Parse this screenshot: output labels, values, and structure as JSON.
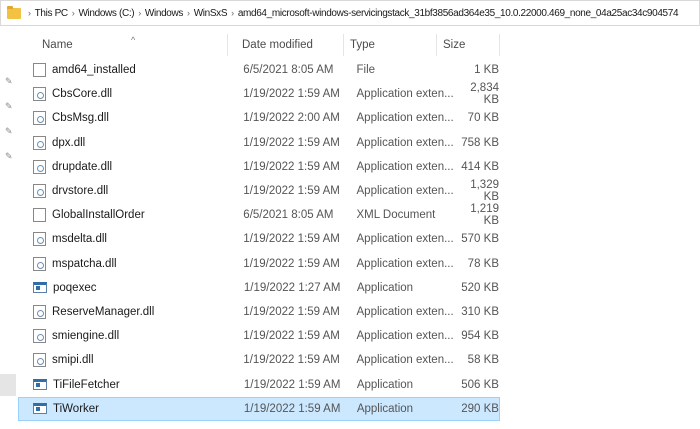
{
  "breadcrumb": [
    "This PC",
    "Windows (C:)",
    "Windows",
    "WinSxS",
    "amd64_microsoft-windows-servicingstack_31bf3856ad364e35_10.0.22000.469_none_04a25ac34c904574"
  ],
  "columns": {
    "name": "Name",
    "date": "Date modified",
    "type": "Type",
    "size": "Size"
  },
  "files": [
    {
      "name": "amd64_installed",
      "date": "6/5/2021 8:05 AM",
      "type": "File",
      "size": "1 KB",
      "icon": "file"
    },
    {
      "name": "CbsCore.dll",
      "date": "1/19/2022 1:59 AM",
      "type": "Application exten...",
      "size": "2,834 KB",
      "icon": "dll"
    },
    {
      "name": "CbsMsg.dll",
      "date": "1/19/2022 2:00 AM",
      "type": "Application exten...",
      "size": "70 KB",
      "icon": "dll"
    },
    {
      "name": "dpx.dll",
      "date": "1/19/2022 1:59 AM",
      "type": "Application exten...",
      "size": "758 KB",
      "icon": "dll"
    },
    {
      "name": "drupdate.dll",
      "date": "1/19/2022 1:59 AM",
      "type": "Application exten...",
      "size": "414 KB",
      "icon": "dll"
    },
    {
      "name": "drvstore.dll",
      "date": "1/19/2022 1:59 AM",
      "type": "Application exten...",
      "size": "1,329 KB",
      "icon": "dll"
    },
    {
      "name": "GlobalInstallOrder",
      "date": "6/5/2021 8:05 AM",
      "type": "XML Document",
      "size": "1,219 KB",
      "icon": "file"
    },
    {
      "name": "msdelta.dll",
      "date": "1/19/2022 1:59 AM",
      "type": "Application exten...",
      "size": "570 KB",
      "icon": "dll"
    },
    {
      "name": "mspatcha.dll",
      "date": "1/19/2022 1:59 AM",
      "type": "Application exten...",
      "size": "78 KB",
      "icon": "dll"
    },
    {
      "name": "poqexec",
      "date": "1/19/2022 1:27 AM",
      "type": "Application",
      "size": "520 KB",
      "icon": "app"
    },
    {
      "name": "ReserveManager.dll",
      "date": "1/19/2022 1:59 AM",
      "type": "Application exten...",
      "size": "310 KB",
      "icon": "dll"
    },
    {
      "name": "smiengine.dll",
      "date": "1/19/2022 1:59 AM",
      "type": "Application exten...",
      "size": "954 KB",
      "icon": "dll"
    },
    {
      "name": "smipi.dll",
      "date": "1/19/2022 1:59 AM",
      "type": "Application exten...",
      "size": "58 KB",
      "icon": "dll"
    },
    {
      "name": "TiFileFetcher",
      "date": "1/19/2022 1:59 AM",
      "type": "Application",
      "size": "506 KB",
      "icon": "app"
    },
    {
      "name": "TiWorker",
      "date": "1/19/2022 1:59 AM",
      "type": "Application",
      "size": "290 KB",
      "icon": "app",
      "selected": true
    }
  ]
}
